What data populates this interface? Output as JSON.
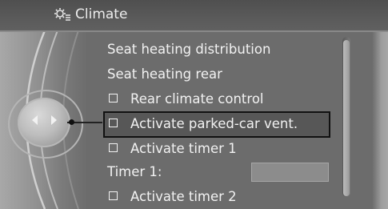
{
  "header": {
    "title": "Climate",
    "icon": "climate-settings-icon"
  },
  "menu": {
    "items": [
      {
        "label": "Seat heating distribution",
        "checkbox": false
      },
      {
        "label": "Seat heating rear",
        "checkbox": false
      },
      {
        "label": "Rear climate control",
        "checkbox": true
      },
      {
        "label": "Activate parked-car vent.",
        "checkbox": true,
        "selected": true
      },
      {
        "label": "Activate timer 1",
        "checkbox": true
      },
      {
        "label": "Timer 1:",
        "checkbox": false
      },
      {
        "label": "Activate timer 2",
        "checkbox": true
      }
    ]
  },
  "colors": {
    "background": "#6c6c6c",
    "text": "#f2f2f2",
    "selection_border": "#111111"
  }
}
